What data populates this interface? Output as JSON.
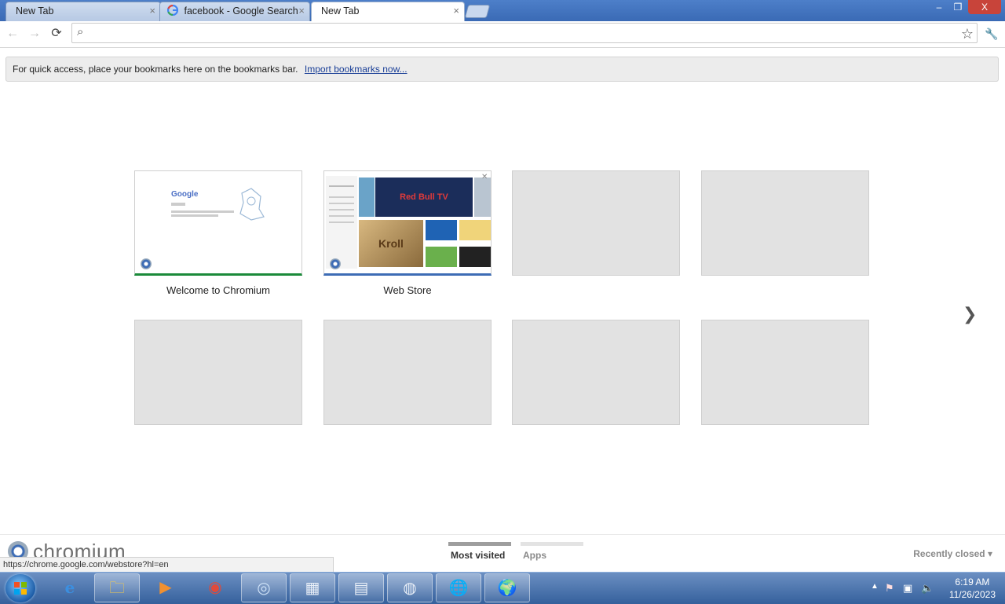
{
  "tabs": [
    {
      "label": "New Tab",
      "active": false,
      "close": "×"
    },
    {
      "label": "facebook - Google Search",
      "active": false,
      "close": "×",
      "favicon": "google-g-icon"
    },
    {
      "label": "New Tab",
      "active": true,
      "close": "×"
    }
  ],
  "window_controls": {
    "minimize": "–",
    "maximize": "❐",
    "close": "X"
  },
  "toolbar": {
    "back_icon": "←",
    "forward_icon": "→",
    "reload_icon": "⟳",
    "search_icon": "⌕",
    "star_icon": "☆",
    "wrench_icon": "🔧",
    "omnibox_value": ""
  },
  "bookmark_bar": {
    "text": "For quick access, place your bookmarks here on the bookmarks bar.",
    "link": "Import bookmarks now..."
  },
  "most_visited": [
    {
      "title": "Welcome to Chromium",
      "filled": true
    },
    {
      "title": "Web Store",
      "filled": true
    },
    {
      "title": "",
      "filled": false
    },
    {
      "title": "",
      "filled": false
    },
    {
      "title": "",
      "filled": false
    },
    {
      "title": "",
      "filled": false
    },
    {
      "title": "",
      "filled": false
    },
    {
      "title": "",
      "filled": false
    }
  ],
  "thumbnail_text": {
    "google_logo": "Google",
    "webstore_banner": "Red Bull TV",
    "webstore_tile": "Kroll"
  },
  "next_arrow": "❯",
  "footer": {
    "brand": "chromium",
    "sections": [
      {
        "label": "Most visited",
        "active": true
      },
      {
        "label": "Apps",
        "active": false
      }
    ],
    "recently_closed": "Recently closed ▾"
  },
  "status_url": "https://chrome.google.com/webstore?hl=en",
  "taskbar": {
    "items": [
      {
        "name": "internet-explorer-icon",
        "glyph": "e"
      },
      {
        "name": "file-explorer-icon",
        "glyph": "🗀"
      },
      {
        "name": "media-player-icon",
        "glyph": "▶"
      },
      {
        "name": "chrome-icon",
        "glyph": "◉"
      },
      {
        "name": "chromium-icon",
        "glyph": "◎"
      },
      {
        "name": "calendar-app-icon",
        "glyph": "▦"
      },
      {
        "name": "control-panel-icon",
        "glyph": "▤"
      },
      {
        "name": "disc-burner-icon",
        "glyph": "◍"
      },
      {
        "name": "globe-icon",
        "glyph": "🌐"
      },
      {
        "name": "network-globe-icon",
        "glyph": "🌍"
      }
    ],
    "clock_time": "6:19 AM",
    "clock_date": "11/26/2023"
  },
  "colors": {
    "titlebar": "#3a6ab5",
    "link": "#1a3f97",
    "welcome_underline": "#1b8a3a",
    "webstore_underline": "#3d6cb5"
  }
}
